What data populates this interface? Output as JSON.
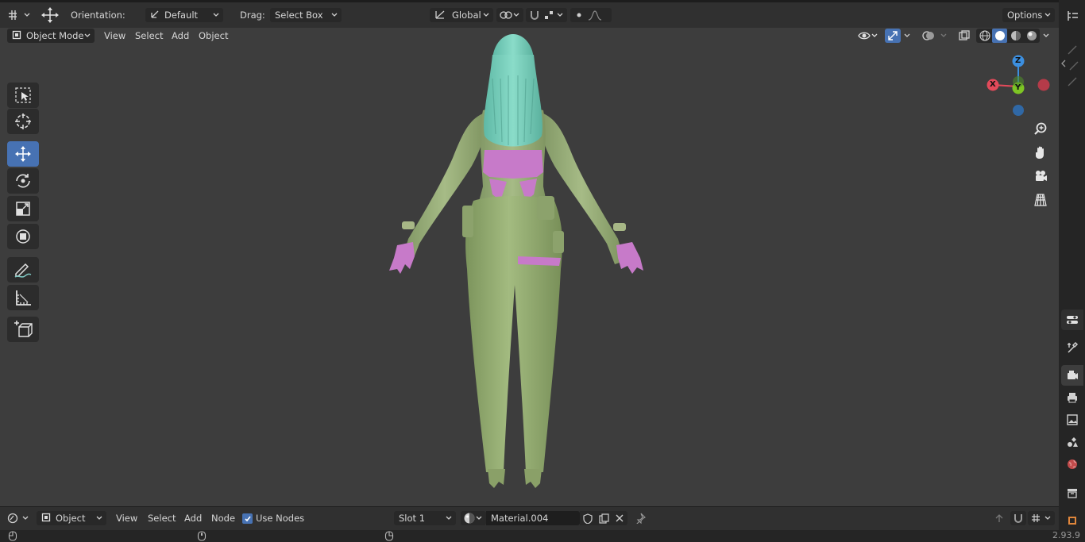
{
  "header": {
    "orientation_label": "Orientation:",
    "orientation_value": "Default",
    "drag_label": "Drag:",
    "drag_value": "Select Box",
    "transform_space": "Global",
    "options_label": "Options"
  },
  "viewport_header": {
    "mode": "Object Mode",
    "menus": [
      "View",
      "Select",
      "Add",
      "Object"
    ]
  },
  "gizmo": {
    "z": "Z",
    "x": "X",
    "y": "Y"
  },
  "shader_editor": {
    "editor_type": "Object",
    "menus": [
      "View",
      "Select",
      "Add",
      "Node"
    ],
    "use_nodes_label": "Use Nodes",
    "use_nodes_checked": true,
    "slot": "Slot 1",
    "material": "Material.004"
  },
  "status": {
    "version": "2.93.9"
  },
  "colors": {
    "accent": "#4772b3",
    "axis_x": "#e24a5a",
    "axis_y": "#7ec524",
    "axis_z": "#3c8fe0",
    "viewport_bg": "#3d3d3d",
    "hair": "#7fd3c0",
    "body_green": "#97ad78",
    "accent_pink": "#c77ac9"
  }
}
